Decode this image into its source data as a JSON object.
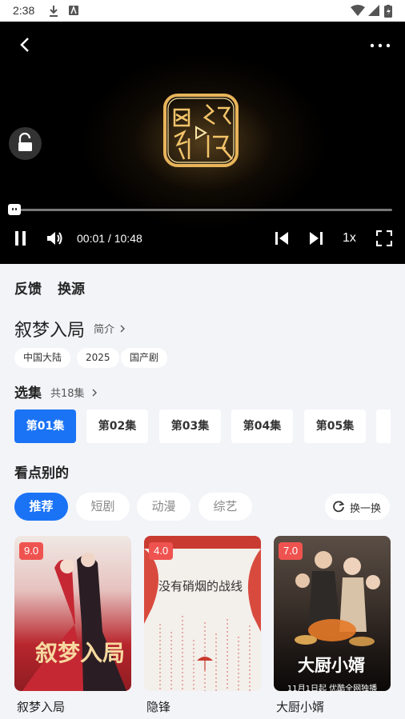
{
  "status": {
    "time": "2:38"
  },
  "player": {
    "time_display": "00:01 / 10:48",
    "speed": "1x",
    "progress": 0.0015
  },
  "actions": {
    "feedback": "反馈",
    "switch_source": "换源"
  },
  "show": {
    "title": "叙梦入局",
    "intro_label": "简介",
    "tags": [
      "中国大陆",
      "2025",
      "国产剧"
    ]
  },
  "episodes": {
    "title": "选集",
    "total": "共18集",
    "items": [
      "第01集",
      "第02集",
      "第03集",
      "第04集",
      "第05集"
    ]
  },
  "recommend": {
    "title": "看点别的",
    "categories": [
      "推荐",
      "短剧",
      "动漫",
      "综艺"
    ],
    "refresh_label": "换一换",
    "cards": [
      {
        "title": "叙梦入局",
        "score": "9.0",
        "poster_text": "叙梦入局"
      },
      {
        "title": "隐锋",
        "score": "4.0",
        "poster_text": "没有硝烟的战线"
      },
      {
        "title": "大厨小婿",
        "score": "7.0",
        "poster_text": "大厨小婿",
        "poster_sub": "11月1日起 优酷全网独播"
      }
    ]
  },
  "colors": {
    "accent": "#1a73f5",
    "score_badge": "#ef5350",
    "background": "#f3f4f8"
  }
}
